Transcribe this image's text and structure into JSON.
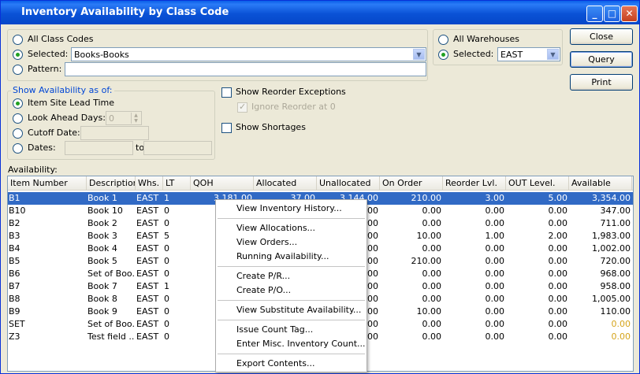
{
  "window": {
    "title": "Inventory Availability by Class Code"
  },
  "class_code": {
    "all_label": "All Class Codes",
    "selected_label": "Selected:",
    "selected_value": "Books-Books",
    "pattern_label": "Pattern:",
    "pattern_value": ""
  },
  "warehouse": {
    "all_label": "All Warehouses",
    "selected_label": "Selected:",
    "selected_value": "EAST"
  },
  "buttons": {
    "close": "Close",
    "query": "Query",
    "print": "Print"
  },
  "availability_as_of": {
    "legend": "Show Availability as of:",
    "item_site_lead_time": "Item Site Lead Time",
    "look_ahead_days": "Look Ahead Days:",
    "look_ahead_value": "0",
    "cutoff_date": "Cutoff Date:",
    "dates": "Dates:",
    "dates_to": "to"
  },
  "options": {
    "show_reorder_exceptions": "Show Reorder Exceptions",
    "ignore_reorder_at_0": "Ignore Reorder at 0",
    "show_shortages": "Show Shortages"
  },
  "table": {
    "label": "Availability:",
    "columns": [
      "Item Number",
      "Description",
      "Whs.",
      "LT",
      "QOH",
      "Allocated",
      "Unallocated",
      "On Order",
      "Reorder Lvl.",
      "OUT Level.",
      "Available"
    ],
    "rows": [
      {
        "item": "B1",
        "desc": "Book 1",
        "whs": "EAST",
        "lt": "1",
        "qoh": "3,181.00",
        "alloc": "37.00",
        "unalloc": "3,144.00",
        "onorder": "210.00",
        "reorder": "3.00",
        "out": "5.00",
        "avail": "3,354.00"
      },
      {
        "item": "B10",
        "desc": "Book 10",
        "whs": "EAST",
        "lt": "0",
        "qoh": "",
        "alloc": "",
        "unalloc": ".00",
        "onorder": "0.00",
        "reorder": "0.00",
        "out": "0.00",
        "avail": "347.00"
      },
      {
        "item": "B2",
        "desc": "Book 2",
        "whs": "EAST",
        "lt": "0",
        "qoh": "",
        "alloc": "",
        "unalloc": ".00",
        "onorder": "0.00",
        "reorder": "0.00",
        "out": "0.00",
        "avail": "711.00"
      },
      {
        "item": "B3",
        "desc": "Book 3",
        "whs": "EAST",
        "lt": "5",
        "qoh": "",
        "alloc": "",
        "unalloc": ".00",
        "onorder": "10.00",
        "reorder": "1.00",
        "out": "2.00",
        "avail": "1,983.00"
      },
      {
        "item": "B4",
        "desc": "Book 4",
        "whs": "EAST",
        "lt": "0",
        "qoh": "",
        "alloc": "",
        "unalloc": ".00",
        "onorder": "0.00",
        "reorder": "0.00",
        "out": "0.00",
        "avail": "1,002.00"
      },
      {
        "item": "B5",
        "desc": "Book 5",
        "whs": "EAST",
        "lt": "0",
        "qoh": "",
        "alloc": "",
        "unalloc": ".00",
        "onorder": "210.00",
        "reorder": "0.00",
        "out": "0.00",
        "avail": "720.00"
      },
      {
        "item": "B6",
        "desc": "Set of Boo...",
        "whs": "EAST",
        "lt": "0",
        "qoh": "",
        "alloc": "",
        "unalloc": ".00",
        "onorder": "0.00",
        "reorder": "0.00",
        "out": "0.00",
        "avail": "968.00"
      },
      {
        "item": "B7",
        "desc": "Book 7",
        "whs": "EAST",
        "lt": "1",
        "qoh": "",
        "alloc": "",
        "unalloc": ".00",
        "onorder": "0.00",
        "reorder": "0.00",
        "out": "0.00",
        "avail": "958.00"
      },
      {
        "item": "B8",
        "desc": "Book 8",
        "whs": "EAST",
        "lt": "0",
        "qoh": "",
        "alloc": "",
        "unalloc": ".00",
        "onorder": "0.00",
        "reorder": "0.00",
        "out": "0.00",
        "avail": "1,005.00"
      },
      {
        "item": "B9",
        "desc": "Book 9",
        "whs": "EAST",
        "lt": "0",
        "qoh": "",
        "alloc": "",
        "unalloc": ".00",
        "onorder": "10.00",
        "reorder": "0.00",
        "out": "0.00",
        "avail": "110.00"
      },
      {
        "item": "SET",
        "desc": "Set of Boo...",
        "whs": "EAST",
        "lt": "0",
        "qoh": "",
        "alloc": "",
        "unalloc": ".00",
        "onorder": "0.00",
        "reorder": "0.00",
        "out": "0.00",
        "avail": "0.00"
      },
      {
        "item": "Z3",
        "desc": "Test field ...",
        "whs": "EAST",
        "lt": "0",
        "qoh": "",
        "alloc": "",
        "unalloc": ".00",
        "onorder": "0.00",
        "reorder": "0.00",
        "out": "0.00",
        "avail": "0.00"
      }
    ]
  },
  "context_menu": {
    "items": [
      "View Inventory History...",
      "View Allocations...",
      "View Orders...",
      "Running Availability...",
      "Create P/R...",
      "Create P/O...",
      "View Substitute Availability...",
      "Issue Count Tag...",
      "Enter Misc. Inventory Count...",
      "Export Contents..."
    ]
  },
  "colors": {
    "selection": "#316ac5",
    "zero_available": "#d5a41b",
    "titlebar": "#0a52d6"
  }
}
